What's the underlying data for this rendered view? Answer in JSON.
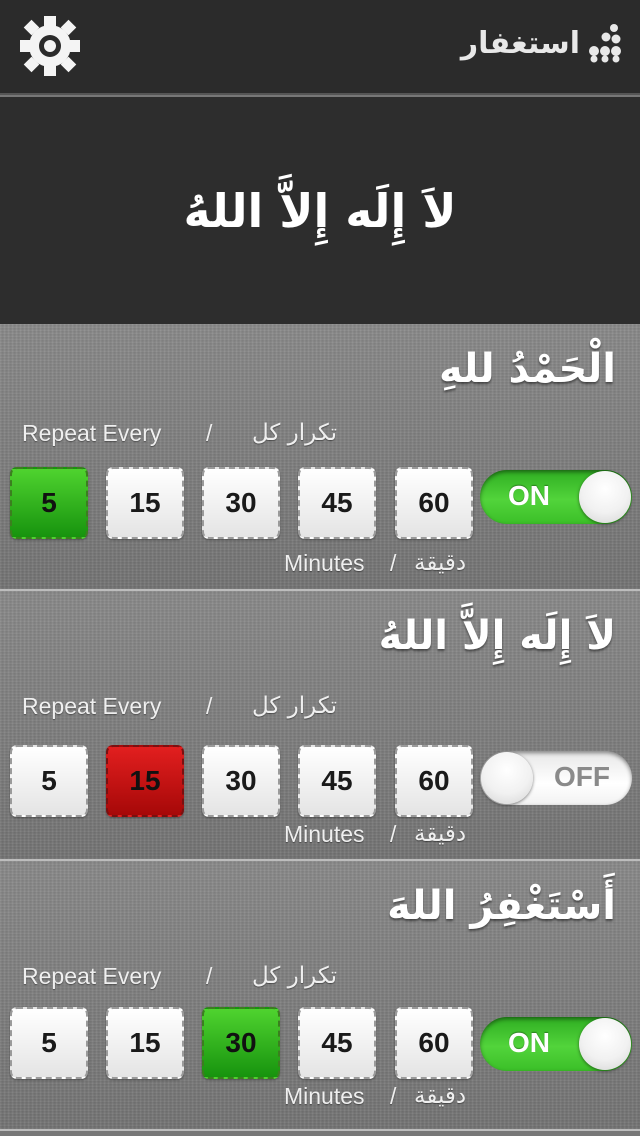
{
  "header": {
    "app_name": "استغفار",
    "settings_icon": "gear-icon",
    "logo_icon": "dots-logo-icon"
  },
  "hero": {
    "text": "لاَ إِلَه إِلاَّ اللهُ"
  },
  "labels": {
    "repeat_en": "Repeat Every",
    "repeat_ar": "تكرار كل",
    "slash": "/",
    "minutes_en": "Minutes",
    "minutes_ar": "دقيقة"
  },
  "reminders": [
    {
      "dhikr": "الْحَمْدُ للهِ",
      "intervals": [
        "5",
        "15",
        "30",
        "45",
        "60"
      ],
      "selected": "5",
      "selected_color": "#2fb51f",
      "toggle_label": "ON",
      "enabled": true
    },
    {
      "dhikr": "لاَ إِلَه إِلاَّ اللهُ",
      "intervals": [
        "5",
        "15",
        "30",
        "45",
        "60"
      ],
      "selected": "15",
      "selected_color": "#c41212",
      "toggle_label": "OFF",
      "enabled": false
    },
    {
      "dhikr": "أَسْتَغْفِرُ اللهَ",
      "intervals": [
        "5",
        "15",
        "30",
        "45",
        "60"
      ],
      "selected": "30",
      "selected_color": "#2fb51f",
      "toggle_label": "ON",
      "enabled": true
    }
  ]
}
